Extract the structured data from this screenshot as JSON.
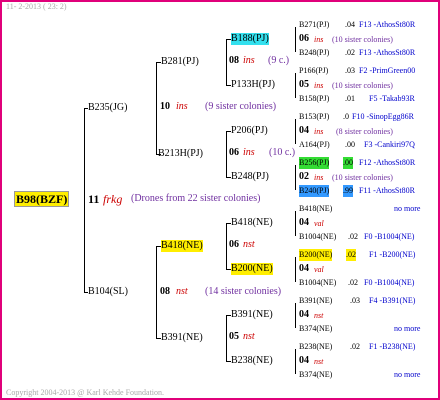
{
  "header": "11-  2-2013 ( 23:  2)",
  "footer": "Copyright 2004-2013 @ Karl Kehde Foundation.",
  "root": {
    "id": "B98(BZF)",
    "num": "11",
    "tag": "frkg",
    "note": "(Drones from 22 sister colonies)"
  },
  "g1": [
    {
      "id": "B235(JG)"
    },
    {
      "id": "B104(SL)"
    }
  ],
  "g2": [
    {
      "id": "B281(PJ)"
    },
    {
      "id": "B213H(PJ)"
    },
    {
      "id": "B418(NE)"
    },
    {
      "id": "B391(NE)"
    }
  ],
  "g1rows": [
    {
      "num": "10",
      "tag": "ins",
      "note": "(9 sister colonies)"
    },
    {
      "num": "08",
      "tag": "nst",
      "note": "(14 sister colonies)"
    }
  ],
  "g2rows": [
    {
      "num": "08",
      "tag": "ins",
      "note": "(9 c.)"
    },
    {
      "num": "06",
      "tag": "ins",
      "note": "(10 c.)"
    },
    {
      "num": "06",
      "tag": "nst",
      "note": ""
    },
    {
      "num": "05",
      "tag": "nst",
      "note": ""
    }
  ],
  "g3": [
    {
      "id": "B188(PJ)"
    },
    {
      "id": "P133H(PJ)"
    },
    {
      "id": "P206(PJ)"
    },
    {
      "id": "B248(PJ)"
    },
    {
      "id": "B418(NE)"
    },
    {
      "id": "B200(NE)"
    },
    {
      "id": "B391(NE)"
    },
    {
      "id": "B238(NE)"
    }
  ],
  "g4": [
    {
      "id": "B271(PJ)",
      "val": ".04",
      "code": "F13 -AthosSt80R"
    },
    {
      "id": "B248(PJ)",
      "val": ".02",
      "code": "F13 -AthosSt80R"
    },
    {
      "id": "P166(PJ)",
      "val": ".03",
      "code": "F2 -PrimGreen00"
    },
    {
      "id": "B158(PJ)",
      "val": ".01",
      "code": "F5 -Takab93R"
    },
    {
      "id": "B153(PJ)",
      "val": ".0",
      "code": "F10 -SinopEgg86R"
    },
    {
      "id": "A164(PJ)",
      "val": ".00",
      "code": "F3 -Cankiri97Q"
    },
    {
      "id": "B256(PJ)",
      "val": ".00",
      "code": "F12 -AthosSt80R"
    },
    {
      "id": "B240(PJ)",
      "val": ".99",
      "code": "F11 -AthosSt80R"
    },
    {
      "id": "B418(NE)",
      "val": "",
      "code": "no more"
    },
    {
      "id": "B1004(NE)",
      "val": ".02",
      "code": "F0 -B1004(NE)"
    },
    {
      "id": "B200(NE)",
      "val": ".02",
      "code": "F1 -B200(NE)"
    },
    {
      "id": "B1004(NE)",
      "val": ".02",
      "code": "F0 -B1004(NE)"
    },
    {
      "id": "B391(NE)",
      "val": ".03",
      "code": "F4 -B391(NE)"
    },
    {
      "id": "B374(NE)",
      "val": "",
      "code": "no more"
    },
    {
      "id": "B238(NE)",
      "val": ".02",
      "code": "F1 -B238(NE)"
    },
    {
      "id": "B374(NE)",
      "val": "",
      "code": "no more"
    }
  ],
  "g3rows": [
    {
      "num": "06",
      "tag": "ins",
      "note": "(10 sister colonies)"
    },
    {
      "num": "05",
      "tag": "ins",
      "note": "(10 sister colonies)"
    },
    {
      "num": "04",
      "tag": "ins",
      "note": "(8 sister colonies)"
    },
    {
      "num": "02",
      "tag": "ins",
      "note": "(10 sister colonies)"
    },
    {
      "num": "04",
      "tag": "val",
      "note": ""
    },
    {
      "num": "04",
      "tag": "val",
      "note": ""
    },
    {
      "num": "04",
      "tag": "nst",
      "note": ""
    },
    {
      "num": "04",
      "tag": "nst",
      "note": ""
    }
  ]
}
